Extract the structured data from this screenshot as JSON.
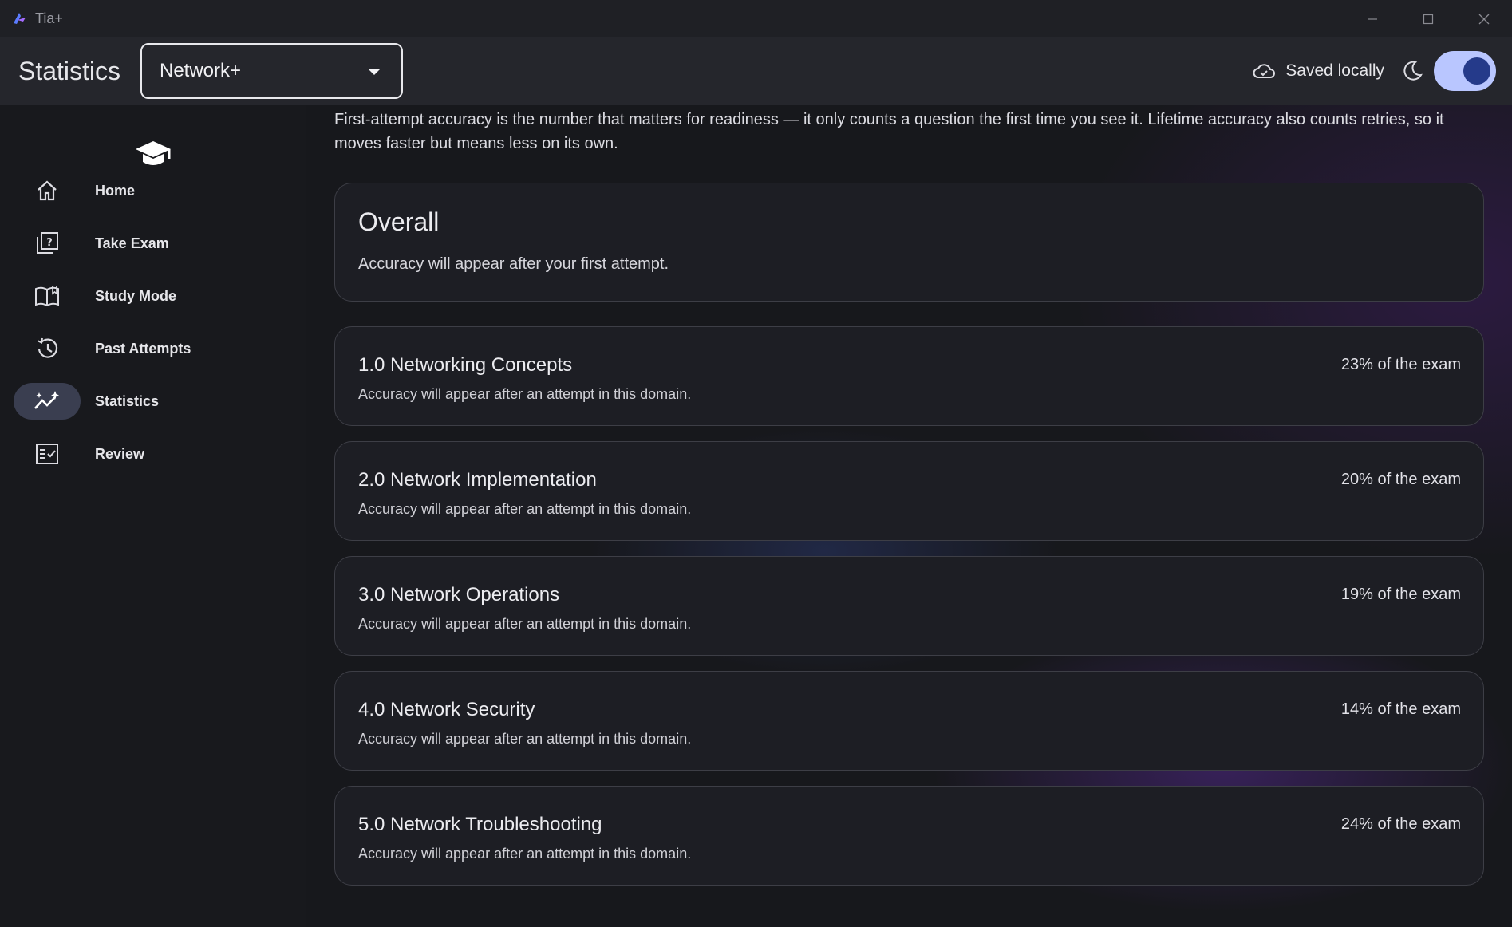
{
  "window": {
    "title": "Tia+"
  },
  "appbar": {
    "page_title": "Statistics",
    "exam_select": {
      "value": "Network+"
    },
    "save_status": "Saved locally",
    "theme_toggle": {
      "dark_mode": true
    }
  },
  "sidebar": {
    "items": [
      {
        "label": "Home",
        "icon": "home-icon",
        "active": false
      },
      {
        "label": "Take Exam",
        "icon": "quiz-icon",
        "active": false
      },
      {
        "label": "Study Mode",
        "icon": "book-icon",
        "active": false
      },
      {
        "label": "Past Attempts",
        "icon": "history-icon",
        "active": false
      },
      {
        "label": "Statistics",
        "icon": "trending-icon",
        "active": true
      },
      {
        "label": "Review",
        "icon": "checklist-icon",
        "active": false
      }
    ]
  },
  "main": {
    "intro": "First-attempt accuracy is the number that matters for readiness — it only counts a question the first time you see it. Lifetime accuracy also counts retries, so it moves faster but means less on its own.",
    "overall": {
      "title": "Overall",
      "subtitle": "Accuracy will appear after your first attempt."
    },
    "domains": [
      {
        "title": "1.0 Networking Concepts",
        "subtitle": "Accuracy will appear after an attempt in this domain.",
        "weight": "23% of the exam"
      },
      {
        "title": "2.0 Network Implementation",
        "subtitle": "Accuracy will appear after an attempt in this domain.",
        "weight": "20% of the exam"
      },
      {
        "title": "3.0 Network Operations",
        "subtitle": "Accuracy will appear after an attempt in this domain.",
        "weight": "19% of the exam"
      },
      {
        "title": "4.0 Network Security",
        "subtitle": "Accuracy will appear after an attempt in this domain.",
        "weight": "14% of the exam"
      },
      {
        "title": "5.0 Network Troubleshooting",
        "subtitle": "Accuracy will appear after an attempt in this domain.",
        "weight": "24% of the exam"
      }
    ]
  },
  "colors": {
    "accent": "#b9c6ff",
    "accent_dark": "#253a8a",
    "active_nav": "#3a3e50",
    "card_bg": "#1d1e24",
    "card_border": "#3d3e46"
  }
}
